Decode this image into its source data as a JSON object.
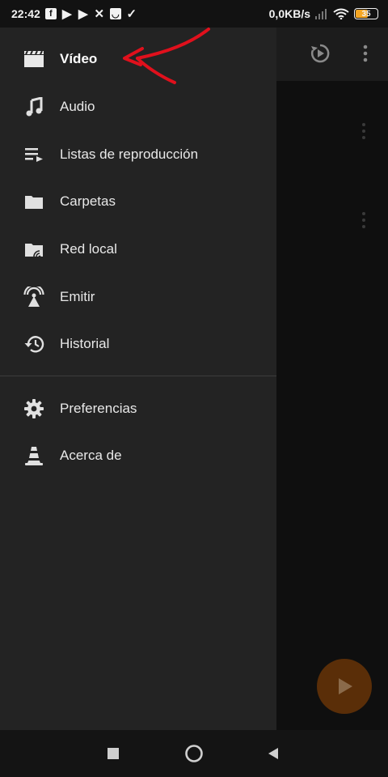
{
  "status_bar": {
    "time": "22:42",
    "notification_icons": [
      "facebook-icon",
      "youtube-icon",
      "youtube-icon",
      "x-icon",
      "smile-icon",
      "check-icon"
    ],
    "net_speed": "0,0KB/s",
    "battery": "35",
    "battery_color": "#f5a623"
  },
  "drawer": {
    "items": [
      {
        "label": "Vídeo",
        "icon": "video-clapper-icon",
        "active": true
      },
      {
        "label": "Audio",
        "icon": "music-note-icon"
      },
      {
        "label": "Listas de reproducción",
        "icon": "playlist-icon"
      },
      {
        "label": "Carpetas",
        "icon": "folder-icon"
      },
      {
        "label": "Red local",
        "icon": "network-folder-icon"
      },
      {
        "label": "Emitir",
        "icon": "broadcast-icon"
      },
      {
        "label": "Historial",
        "icon": "history-icon"
      }
    ],
    "secondary_items": [
      {
        "label": "Preferencias",
        "icon": "gear-icon"
      },
      {
        "label": "Acerca de",
        "icon": "vlc-cone-icon"
      }
    ]
  },
  "annotation": {
    "arrow_color": "#e0101c"
  },
  "app": {
    "accent": "#5a2e08"
  }
}
